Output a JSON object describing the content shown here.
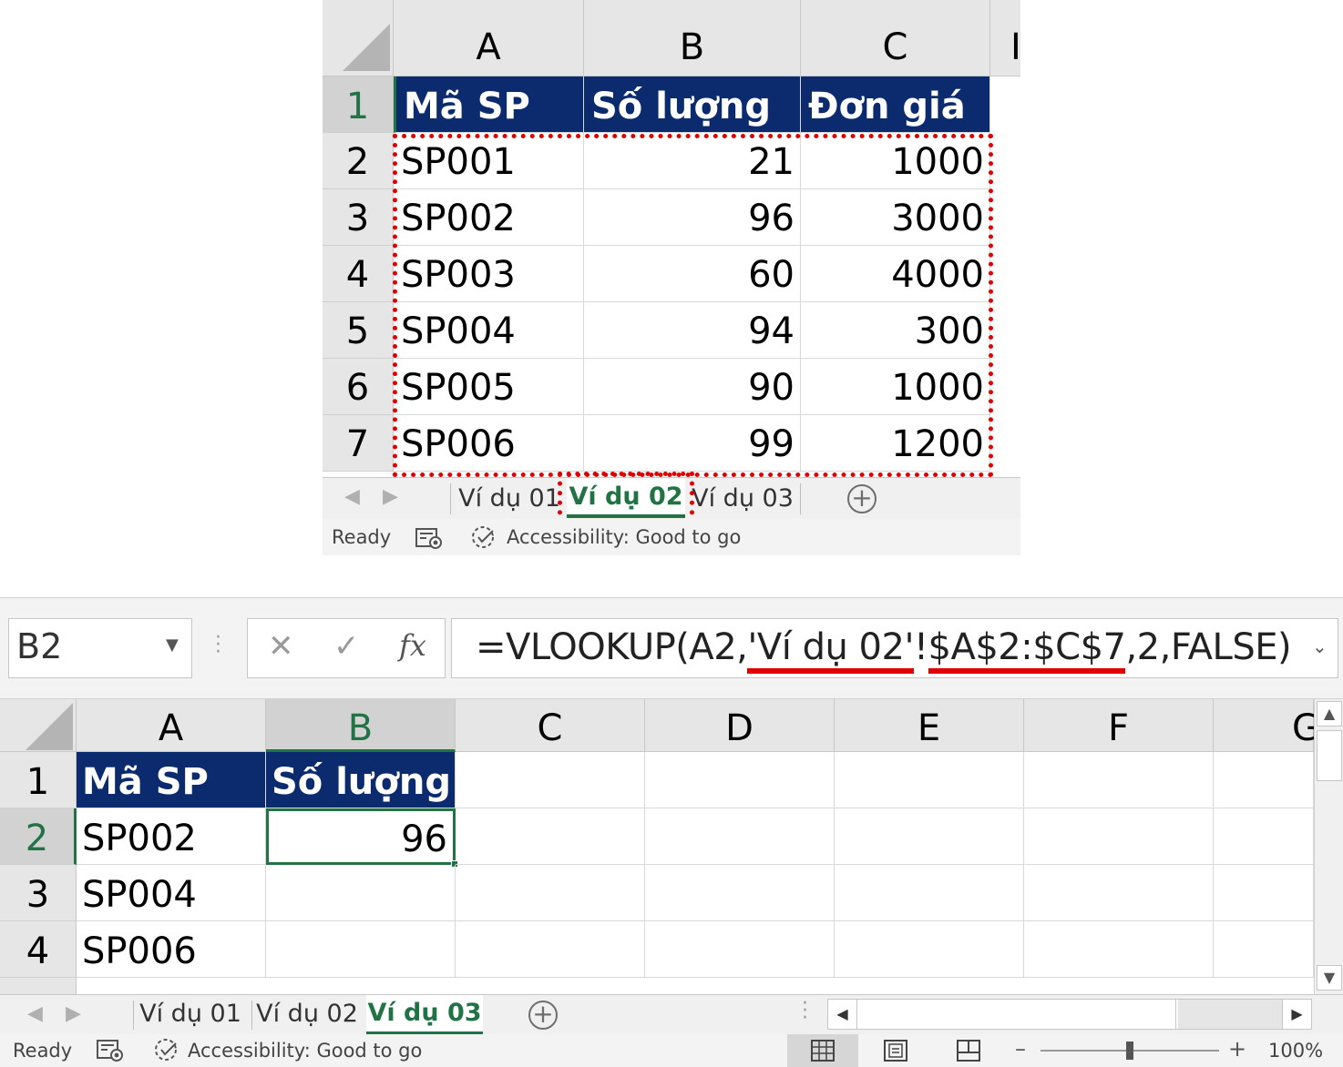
{
  "top_window": {
    "columns": [
      "A",
      "B",
      "C",
      "I"
    ],
    "header_row": {
      "row": "1",
      "a": "Mã SP",
      "b": "Số lượng",
      "c": "Đơn giá"
    },
    "rows": [
      {
        "row": "2",
        "a": "SP001",
        "b": "21",
        "c": "1000"
      },
      {
        "row": "3",
        "a": "SP002",
        "b": "96",
        "c": "3000"
      },
      {
        "row": "4",
        "a": "SP003",
        "b": "60",
        "c": "4000"
      },
      {
        "row": "5",
        "a": "SP004",
        "b": "94",
        "c": "300"
      },
      {
        "row": "6",
        "a": "SP005",
        "b": "90",
        "c": "1000"
      },
      {
        "row": "7",
        "a": "SP006",
        "b": "99",
        "c": "1200"
      }
    ],
    "tabs": [
      "Ví dụ 01",
      "Ví dụ 02",
      "Ví dụ 03"
    ],
    "active_tab": "Ví dụ 02",
    "status": {
      "ready": "Ready",
      "accessibility": "Accessibility: Good to go"
    }
  },
  "bottom_window": {
    "name_box": "B2",
    "fx_label": "fx",
    "formula": {
      "part1": "=VLOOKUP(A2,",
      "part2": "'Ví dụ 02'",
      "part3": "!",
      "part4": "$A$2:$C$7",
      "part5": ",2,FALSE)"
    },
    "columns": [
      "A",
      "B",
      "C",
      "D",
      "E",
      "F",
      "G"
    ],
    "header_row": {
      "row": "1",
      "a": "Mã SP",
      "b": "Số lượng"
    },
    "rows": [
      {
        "row": "2",
        "a": "SP002",
        "b": "96"
      },
      {
        "row": "3",
        "a": "SP004",
        "b": ""
      },
      {
        "row": "4",
        "a": "SP006",
        "b": ""
      }
    ],
    "tabs": [
      "Ví dụ 01",
      "Ví dụ 02",
      "Ví dụ 03"
    ],
    "active_tab": "Ví dụ 03",
    "status": {
      "ready": "Ready",
      "accessibility": "Accessibility: Good to go",
      "zoom": "100%"
    }
  },
  "colors": {
    "header_fill": "#0c2b6e",
    "excel_green": "#217346",
    "highlight_red": "#e00000"
  },
  "icons": [
    "cancel-icon",
    "enter-icon",
    "fx-icon",
    "dropdown-icon",
    "add-sheet-icon",
    "macro-record-icon",
    "accessibility-icon",
    "normal-view-icon",
    "page-layout-icon",
    "page-break-icon"
  ]
}
